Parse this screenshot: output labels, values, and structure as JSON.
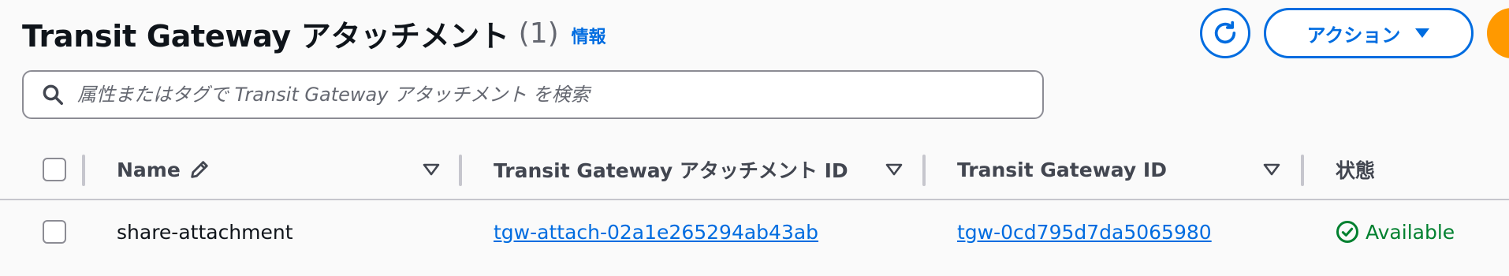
{
  "header": {
    "title": "Transit Gateway アタッチメント",
    "count": "(1)",
    "info_link": "情報"
  },
  "toolbar": {
    "refresh_icon": "refresh-icon",
    "actions_label": "アクション",
    "actions_icon": "caret-down-icon"
  },
  "search": {
    "placeholder": "属性またはタグで Transit Gateway アタッチメント を検索",
    "value": "",
    "icon": "search-icon"
  },
  "table": {
    "columns": [
      {
        "label": "Name",
        "icon": "edit-pencil-icon"
      },
      {
        "label": "Transit Gateway アタッチメント ID"
      },
      {
        "label": "Transit Gateway ID"
      },
      {
        "label": "状態"
      }
    ],
    "rows": [
      {
        "name": "share-attachment",
        "attachment_id": "tgw-attach-02a1e265294ab43ab",
        "gateway_id": "tgw-0cd795d7da5065980",
        "state": "Available",
        "state_icon": "check-circle-icon"
      }
    ]
  },
  "colors": {
    "link": "#006ce0",
    "success": "#00802f",
    "primary": "#ff9900",
    "text": "#0f141a",
    "muted": "#656871"
  }
}
